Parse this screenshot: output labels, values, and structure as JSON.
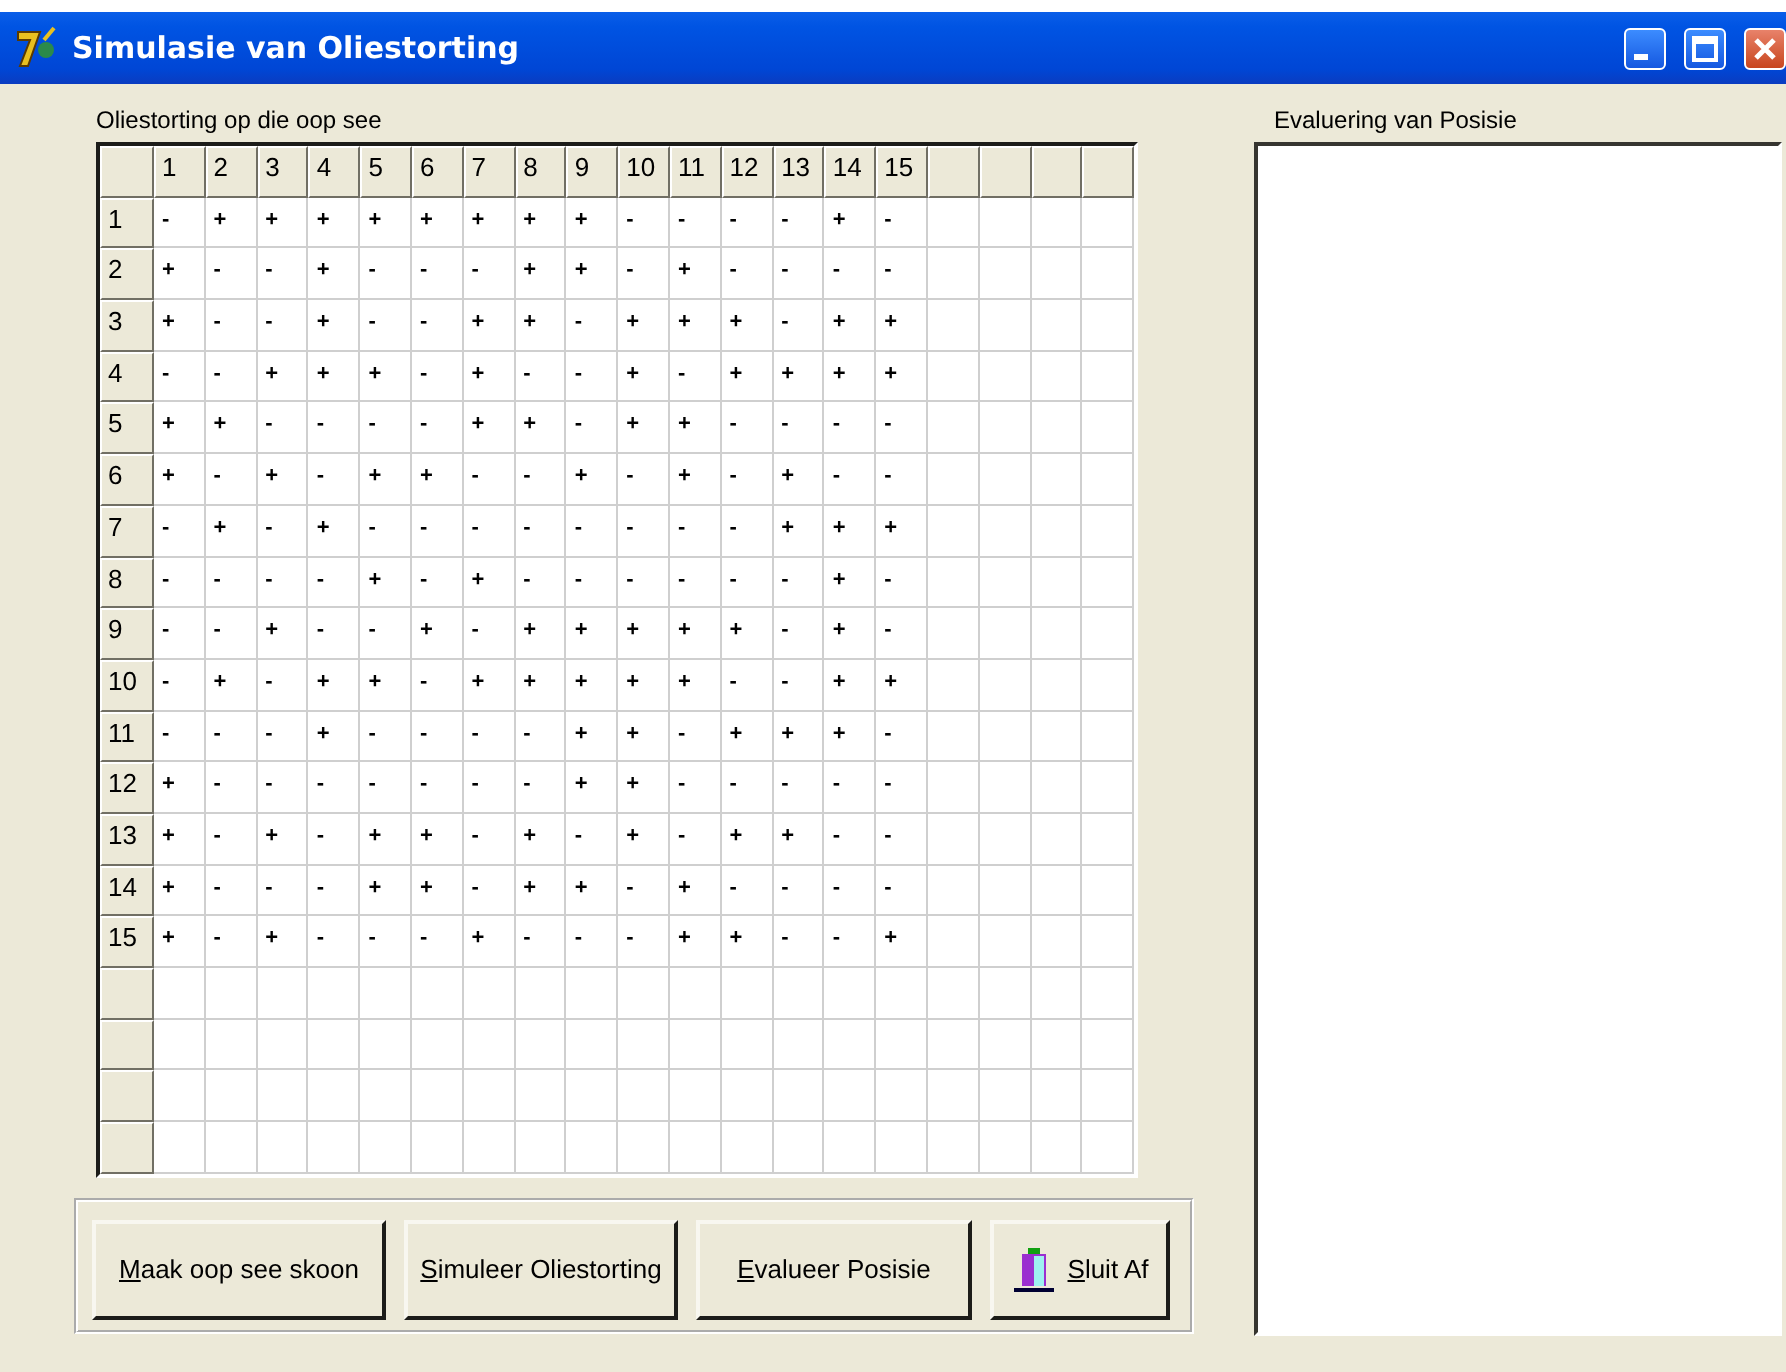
{
  "window": {
    "title": "Simulasie van Oliestorting"
  },
  "grid": {
    "label": "Oliestorting op die oop see",
    "columns": [
      "1",
      "2",
      "3",
      "4",
      "5",
      "6",
      "7",
      "8",
      "9",
      "10",
      "11",
      "12",
      "13",
      "14",
      "15"
    ],
    "rows": [
      {
        "header": "1",
        "cells": [
          "-",
          "+",
          "+",
          "+",
          "+",
          "+",
          "+",
          "+",
          "+",
          "-",
          "-",
          "-",
          "-",
          "+",
          "-"
        ]
      },
      {
        "header": "2",
        "cells": [
          "+",
          "-",
          "-",
          "+",
          "-",
          "-",
          "-",
          "+",
          "+",
          "-",
          "+",
          "-",
          "-",
          "-",
          "-"
        ]
      },
      {
        "header": "3",
        "cells": [
          "+",
          "-",
          "-",
          "+",
          "-",
          "-",
          "+",
          "+",
          "-",
          "+",
          "+",
          "+",
          "-",
          "+",
          "+"
        ]
      },
      {
        "header": "4",
        "cells": [
          "-",
          "-",
          "+",
          "+",
          "+",
          "-",
          "+",
          "-",
          "-",
          "+",
          "-",
          "+",
          "+",
          "+",
          "+"
        ]
      },
      {
        "header": "5",
        "cells": [
          "+",
          "+",
          "-",
          "-",
          "-",
          "-",
          "+",
          "+",
          "-",
          "+",
          "+",
          "-",
          "-",
          "-",
          "-"
        ]
      },
      {
        "header": "6",
        "cells": [
          "+",
          "-",
          "+",
          "-",
          "+",
          "+",
          "-",
          "-",
          "+",
          "-",
          "+",
          "-",
          "+",
          "-",
          "-"
        ]
      },
      {
        "header": "7",
        "cells": [
          "-",
          "+",
          "-",
          "+",
          "-",
          "-",
          "-",
          "-",
          "-",
          "-",
          "-",
          "-",
          "+",
          "+",
          "+"
        ]
      },
      {
        "header": "8",
        "cells": [
          "-",
          "-",
          "-",
          "-",
          "+",
          "-",
          "+",
          "-",
          "-",
          "-",
          "-",
          "-",
          "-",
          "+",
          "-"
        ]
      },
      {
        "header": "9",
        "cells": [
          "-",
          "-",
          "+",
          "-",
          "-",
          "+",
          "-",
          "+",
          "+",
          "+",
          "+",
          "+",
          "-",
          "+",
          "-"
        ]
      },
      {
        "header": "10",
        "cells": [
          "-",
          "+",
          "-",
          "+",
          "+",
          "-",
          "+",
          "+",
          "+",
          "+",
          "+",
          "-",
          "-",
          "+",
          "+"
        ]
      },
      {
        "header": "11",
        "cells": [
          "-",
          "-",
          "-",
          "+",
          "-",
          "-",
          "-",
          "-",
          "+",
          "+",
          "-",
          "+",
          "+",
          "+",
          "-"
        ]
      },
      {
        "header": "12",
        "cells": [
          "+",
          "-",
          "-",
          "-",
          "-",
          "-",
          "-",
          "-",
          "+",
          "+",
          "-",
          "-",
          "-",
          "-",
          "-"
        ]
      },
      {
        "header": "13",
        "cells": [
          "+",
          "-",
          "+",
          "-",
          "+",
          "+",
          "-",
          "+",
          "-",
          "+",
          "-",
          "+",
          "+",
          "-",
          "-"
        ]
      },
      {
        "header": "14",
        "cells": [
          "+",
          "-",
          "-",
          "-",
          "+",
          "+",
          "-",
          "+",
          "+",
          "-",
          "+",
          "-",
          "-",
          "-",
          "-"
        ]
      },
      {
        "header": "15",
        "cells": [
          "+",
          "-",
          "+",
          "-",
          "-",
          "-",
          "+",
          "-",
          "-",
          "-",
          "+",
          "+",
          "-",
          "-",
          "+"
        ]
      }
    ]
  },
  "evaluation": {
    "label": "Evaluering van Posisie"
  },
  "buttons": [
    {
      "kind": "text",
      "mnemonic": "M",
      "label": "aak oop see skoon"
    },
    {
      "kind": "text",
      "mnemonic": "S",
      "label": "imuleer Oliestorting"
    },
    {
      "kind": "text",
      "mnemonic": "E",
      "label": "valueer Posisie"
    },
    {
      "kind": "exit",
      "mnemonic": "S",
      "label": "luit Af"
    }
  ]
}
